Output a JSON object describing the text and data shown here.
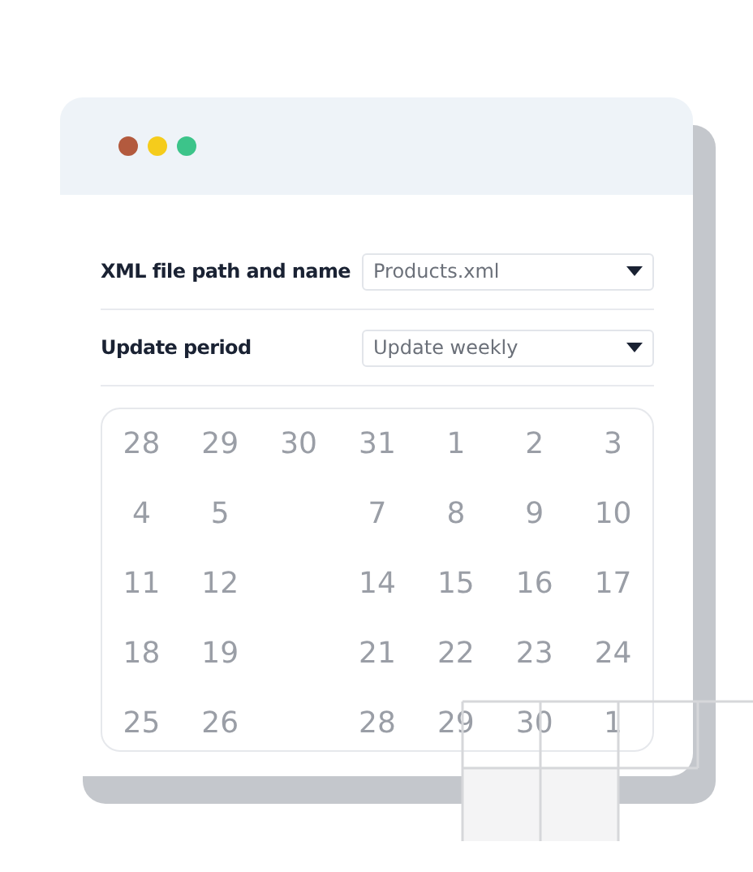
{
  "window": {
    "dots": [
      {
        "color": "#b35a3e"
      },
      {
        "color": "#f5cc1c"
      },
      {
        "color": "#3cc48a"
      }
    ]
  },
  "fields": [
    {
      "label": "XML file path and name",
      "value": "Products.xml"
    },
    {
      "label": "Update period",
      "value": "Update weekly"
    }
  ],
  "calendar": {
    "weeks": [
      [
        {
          "kind": "day",
          "day": "28"
        },
        {
          "kind": "day",
          "day": "29"
        },
        {
          "kind": "day",
          "day": "30"
        },
        {
          "kind": "day",
          "day": "31"
        },
        {
          "kind": "day",
          "day": "1"
        },
        {
          "kind": "day",
          "day": "2"
        },
        {
          "kind": "day",
          "day": "3"
        }
      ],
      [
        {
          "kind": "day",
          "day": "4"
        },
        {
          "kind": "day",
          "day": "5"
        },
        {
          "kind": "blank"
        },
        {
          "kind": "day",
          "day": "7"
        },
        {
          "kind": "day",
          "day": "8"
        },
        {
          "kind": "day",
          "day": "9"
        },
        {
          "kind": "day",
          "day": "10"
        }
      ],
      [
        {
          "kind": "day",
          "day": "11"
        },
        {
          "kind": "day",
          "day": "12"
        },
        {
          "kind": "blank"
        },
        {
          "kind": "day",
          "day": "14"
        },
        {
          "kind": "day",
          "day": "15"
        },
        {
          "kind": "day",
          "day": "16"
        },
        {
          "kind": "day",
          "day": "17"
        }
      ],
      [
        {
          "kind": "day",
          "day": "18"
        },
        {
          "kind": "day",
          "day": "19"
        },
        {
          "kind": "blank"
        },
        {
          "kind": "day",
          "day": "21"
        },
        {
          "kind": "day",
          "day": "22"
        },
        {
          "kind": "day",
          "day": "23"
        },
        {
          "kind": "day",
          "day": "24"
        }
      ],
      [
        {
          "kind": "day",
          "day": "25"
        },
        {
          "kind": "day",
          "day": "26"
        },
        {
          "kind": "blank"
        },
        {
          "kind": "day",
          "day": "28"
        },
        {
          "kind": "day",
          "day": "29"
        },
        {
          "kind": "day",
          "day": "30"
        },
        {
          "kind": "day",
          "day": "1"
        }
      ]
    ]
  }
}
